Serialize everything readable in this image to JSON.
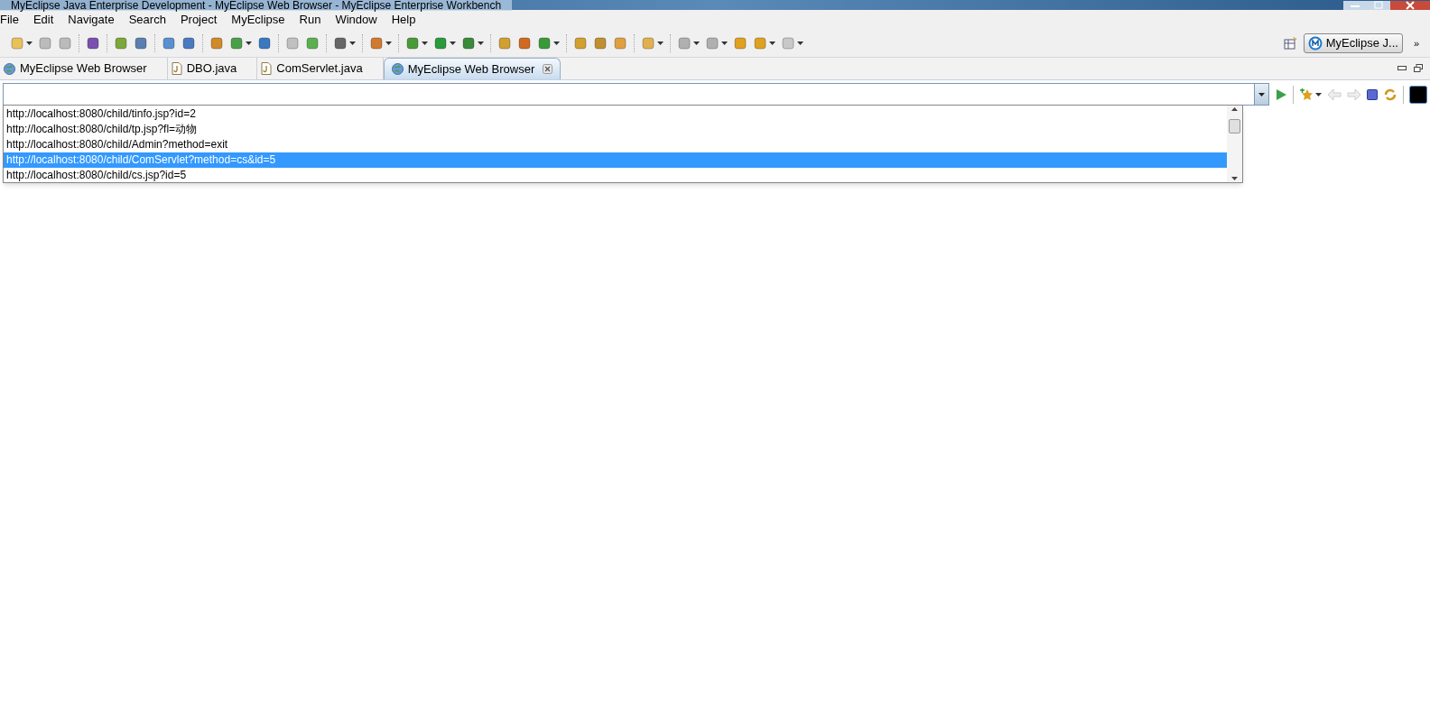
{
  "window": {
    "title": "MyEclipse Java Enterprise Development - MyEclipse Web Browser - MyEclipse Enterprise Workbench"
  },
  "menu": [
    "File",
    "Edit",
    "Navigate",
    "Search",
    "Project",
    "MyEclipse",
    "Run",
    "Window",
    "Help"
  ],
  "perspective": {
    "label": "MyEclipse J...",
    "overflow": "»"
  },
  "tabs": [
    {
      "label": "MyEclipse Web Browser",
      "kind": "browser",
      "selected": false
    },
    {
      "label": "DBO.java",
      "kind": "java",
      "selected": false
    },
    {
      "label": "ComServlet.java",
      "kind": "java",
      "selected": false
    },
    {
      "label": "MyEclipse Web Browser",
      "kind": "browser",
      "selected": true
    }
  ],
  "url_dropdown": {
    "items": [
      {
        "label": "http://localhost:8080/child/tinfo.jsp?id=2",
        "selected": false
      },
      {
        "label": "http://localhost:8080/child/tp.jsp?fl=动物",
        "selected": false
      },
      {
        "label": "http://localhost:8080/child/Admin?method=exit",
        "selected": false
      },
      {
        "label": "http://localhost:8080/child/ComServlet?method=cs&id=5",
        "selected": true
      },
      {
        "label": "http://localhost:8080/child/cs.jsp?id=5",
        "selected": false
      }
    ]
  }
}
